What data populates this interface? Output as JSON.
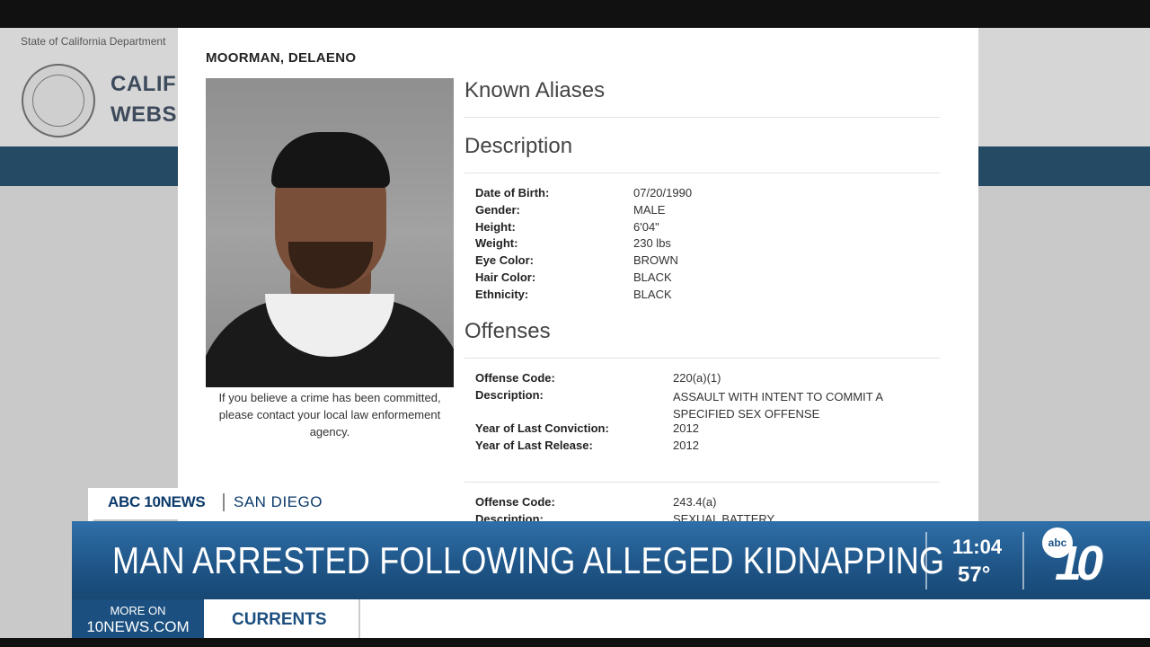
{
  "background_site": {
    "state_text": "State of California Department",
    "title_line1": "CALIF",
    "title_line2": "WEBSI"
  },
  "profile": {
    "name": "MOORMAN, DELAENO",
    "photo_caption": "If you believe a crime has been committed, please contact your local law enformement agency.",
    "known_aliases_title": "Known Aliases",
    "description_title": "Description",
    "description": [
      {
        "label": "Date of Birth:",
        "value": "07/20/1990"
      },
      {
        "label": "Gender:",
        "value": "MALE"
      },
      {
        "label": "Height:",
        "value": "6'04\""
      },
      {
        "label": "Weight:",
        "value": "230 lbs"
      },
      {
        "label": "Eye Color:",
        "value": "BROWN"
      },
      {
        "label": "Hair Color:",
        "value": "BLACK"
      },
      {
        "label": "Ethnicity:",
        "value": "BLACK"
      }
    ],
    "offenses_title": "Offenses",
    "offense1": {
      "code_label": "Offense Code:",
      "code": "220(a)(1)",
      "desc_label": "Description:",
      "desc": "ASSAULT WITH INTENT TO COMMIT A SPECIFIED SEX OFFENSE",
      "conv_label": "Year of Last Conviction:",
      "conv": "2012",
      "rel_label": "Year of Last Release:",
      "rel": "2012"
    },
    "offense2": {
      "code_label": "Offense Code:",
      "code": "243.4(a)",
      "desc_label": "Description:",
      "desc": "SEXUAL BATTERY"
    }
  },
  "broadcast": {
    "brand": "ABC 10NEWS",
    "city": "SAN DIEGO",
    "headline": "MAN ARRESTED FOLLOWING ALLEGED KIDNAPPING",
    "time": "11:04",
    "temperature": "57°",
    "logo_abc": "abc",
    "logo_number": "10",
    "more_on": "MORE ON",
    "site": "10NEWS.COM",
    "section": "CURRENTS"
  },
  "colors": {
    "headline_bar": "#1e5486",
    "brand_blue": "#0d3b6b",
    "site_nav": "#254a63"
  }
}
